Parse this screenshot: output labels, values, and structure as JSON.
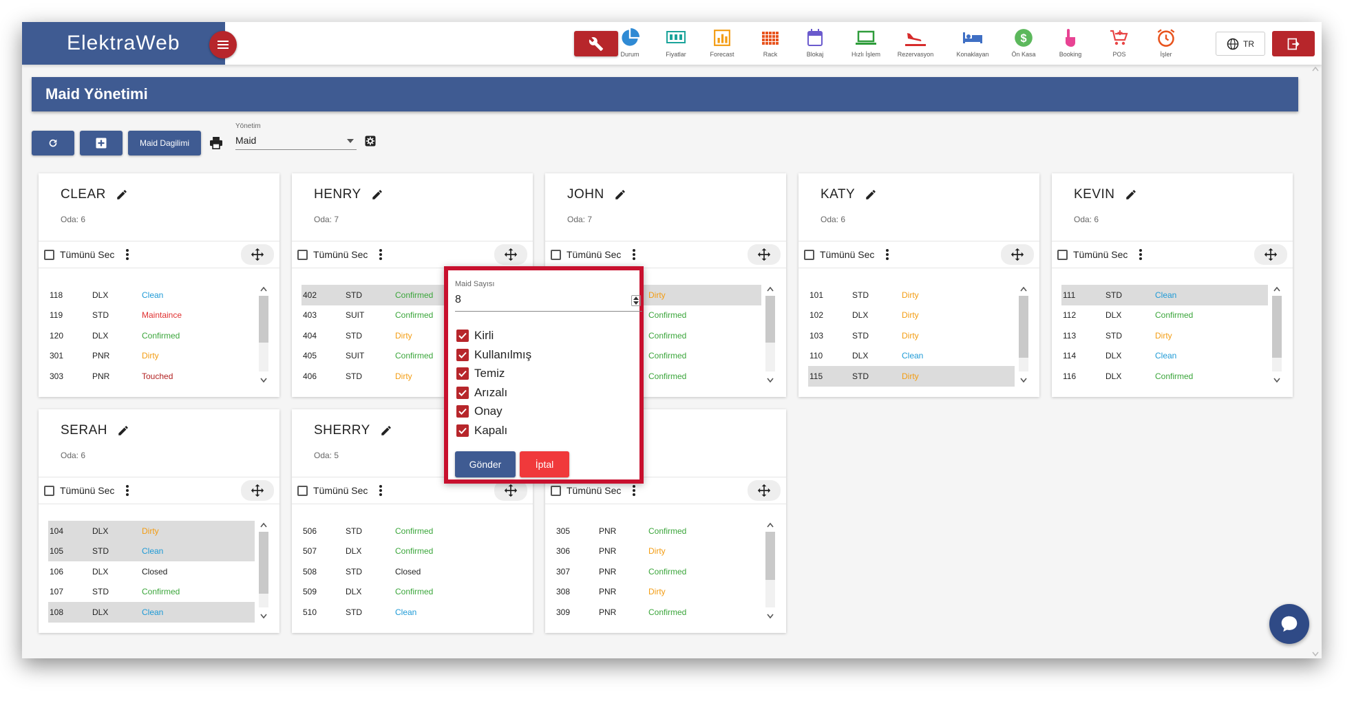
{
  "app": {
    "brand": "ElektraWeb"
  },
  "nav": [
    {
      "label": "Durum",
      "icon": "pie-chart-icon",
      "color": "#2f8ad4"
    },
    {
      "label": "Fiyatlar",
      "icon": "price-board-icon",
      "color": "#1aa39a"
    },
    {
      "label": "Forecast",
      "icon": "bar-chart-icon",
      "color": "#f39c12"
    },
    {
      "label": "Rack",
      "icon": "rack-grid-icon",
      "color": "#e8531d"
    },
    {
      "label": "Blokaj",
      "icon": "calendar-icon",
      "color": "#6a5acd"
    },
    {
      "label": "Hızlı İşlem",
      "icon": "laptop-icon",
      "color": "#2e9c3a"
    },
    {
      "label": "Rezervasyon",
      "icon": "plane-landing-icon",
      "color": "#d62b2b"
    },
    {
      "label": "Konaklayan",
      "icon": "bed-icon",
      "color": "#3f6fc4"
    },
    {
      "label": "Ön Kasa",
      "icon": "dollar-icon",
      "color": "#5cb85c"
    },
    {
      "label": "Booking",
      "icon": "hand-pointer-icon",
      "color": "#e84393"
    },
    {
      "label": "POS",
      "icon": "cart-icon",
      "color": "#e84545"
    },
    {
      "label": "İşler",
      "icon": "alarm-icon",
      "color": "#e8531d"
    }
  ],
  "lang": "TR",
  "page_title": "Maid Yönetimi",
  "toolbar": {
    "distribution_label": "Maid Dagilimi",
    "yonetim_label": "Yönetim",
    "yonetim_value": "Maid"
  },
  "select_all_label": "Tümünü Sec",
  "oda_prefix": "Oda:",
  "colors": {
    "Clean": "#1e9ad6",
    "Maintaince": "#e03030",
    "Confirmed": "#3aa53a",
    "Dirty": "#f39c12",
    "Touched": "#b22222",
    "Closed": "#222222"
  },
  "maids": [
    {
      "name": "CLEAR",
      "oda": "6",
      "rows": [
        {
          "no": "118",
          "type": "DLX",
          "status": "Clean",
          "hl": false
        },
        {
          "no": "119",
          "type": "STD",
          "status": "Maintaince",
          "hl": false
        },
        {
          "no": "120",
          "type": "DLX",
          "status": "Confirmed",
          "hl": false
        },
        {
          "no": "301",
          "type": "PNR",
          "status": "Dirty",
          "hl": false
        },
        {
          "no": "303",
          "type": "PNR",
          "status": "Touched",
          "hl": false
        }
      ]
    },
    {
      "name": "HENRY",
      "oda": "7",
      "rows": [
        {
          "no": "402",
          "type": "STD",
          "status": "Confirmed",
          "hl": true
        },
        {
          "no": "403",
          "type": "SUIT",
          "status": "Confirmed",
          "hl": false
        },
        {
          "no": "404",
          "type": "STD",
          "status": "Dirty",
          "hl": false
        },
        {
          "no": "405",
          "type": "SUIT",
          "status": "Confirmed",
          "hl": false
        },
        {
          "no": "406",
          "type": "STD",
          "status": "Dirty",
          "hl": false
        }
      ]
    },
    {
      "name": "JOHN",
      "oda": "7",
      "rows": [
        {
          "no": "",
          "type": "",
          "status": "Dirty",
          "hl": true
        },
        {
          "no": "",
          "type": "",
          "status": "Confirmed",
          "hl": false
        },
        {
          "no": "",
          "type": "",
          "status": "Confirmed",
          "hl": false
        },
        {
          "no": "",
          "type": "",
          "status": "Confirmed",
          "hl": false
        },
        {
          "no": "",
          "type": "",
          "status": "Confirmed",
          "hl": false
        }
      ]
    },
    {
      "name": "KATY",
      "oda": "6",
      "rows": [
        {
          "no": "101",
          "type": "STD",
          "status": "Dirty",
          "hl": false
        },
        {
          "no": "102",
          "type": "DLX",
          "status": "Dirty",
          "hl": false
        },
        {
          "no": "103",
          "type": "STD",
          "status": "Dirty",
          "hl": false
        },
        {
          "no": "110",
          "type": "DLX",
          "status": "Clean",
          "hl": false
        },
        {
          "no": "115",
          "type": "STD",
          "status": "Dirty",
          "hl": true
        }
      ]
    },
    {
      "name": "KEVIN",
      "oda": "6",
      "rows": [
        {
          "no": "111",
          "type": "STD",
          "status": "Clean",
          "hl": true
        },
        {
          "no": "112",
          "type": "DLX",
          "status": "Confirmed",
          "hl": false
        },
        {
          "no": "113",
          "type": "STD",
          "status": "Dirty",
          "hl": false
        },
        {
          "no": "114",
          "type": "DLX",
          "status": "Clean",
          "hl": false
        },
        {
          "no": "116",
          "type": "DLX",
          "status": "Confirmed",
          "hl": false
        }
      ]
    },
    {
      "name": "SERAH",
      "oda": "6",
      "rows": [
        {
          "no": "104",
          "type": "DLX",
          "status": "Dirty",
          "hl": true
        },
        {
          "no": "105",
          "type": "STD",
          "status": "Clean",
          "hl": true
        },
        {
          "no": "106",
          "type": "DLX",
          "status": "Closed",
          "hl": false
        },
        {
          "no": "107",
          "type": "STD",
          "status": "Confirmed",
          "hl": false
        },
        {
          "no": "108",
          "type": "DLX",
          "status": "Clean",
          "hl": true
        }
      ]
    },
    {
      "name": "SHERRY",
      "oda": "5",
      "rows": [
        {
          "no": "506",
          "type": "STD",
          "status": "Confirmed",
          "hl": false
        },
        {
          "no": "507",
          "type": "DLX",
          "status": "Confirmed",
          "hl": false
        },
        {
          "no": "508",
          "type": "STD",
          "status": "Closed",
          "hl": false
        },
        {
          "no": "509",
          "type": "DLX",
          "status": "Confirmed",
          "hl": false
        },
        {
          "no": "510",
          "type": "STD",
          "status": "Clean",
          "hl": false
        }
      ]
    },
    {
      "name": "",
      "oda": "",
      "rows": [
        {
          "no": "305",
          "type": "PNR",
          "status": "Confirmed",
          "hl": false
        },
        {
          "no": "306",
          "type": "PNR",
          "status": "Dirty",
          "hl": false
        },
        {
          "no": "307",
          "type": "PNR",
          "status": "Confirmed",
          "hl": false
        },
        {
          "no": "308",
          "type": "PNR",
          "status": "Dirty",
          "hl": false
        },
        {
          "no": "309",
          "type": "PNR",
          "status": "Confirmed",
          "hl": false
        }
      ]
    }
  ],
  "modal": {
    "maid_count_label": "Maid Sayısı",
    "maid_count_value": "8",
    "options": [
      "Kirli",
      "Kullanılmış",
      "Temiz",
      "Arızalı",
      "Onay",
      "Kapalı"
    ],
    "send_label": "Gönder",
    "cancel_label": "İptal"
  }
}
